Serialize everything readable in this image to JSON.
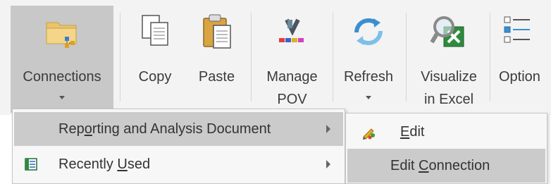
{
  "ribbon": {
    "connections": {
      "label": "Connections",
      "icon": "folder-connections-icon"
    },
    "copy": {
      "label": "Copy",
      "icon": "copy-icon"
    },
    "paste": {
      "label": "Paste",
      "icon": "paste-icon"
    },
    "manage_pov": {
      "line1": "Manage",
      "line2": "POV",
      "icon": "manage-pov-icon"
    },
    "refresh": {
      "label": "Refresh",
      "icon": "refresh-icon"
    },
    "visualize": {
      "line1": "Visualize",
      "line2": "in Excel",
      "icon": "visualize-excel-icon"
    },
    "options": {
      "label": "Option",
      "icon": "options-list-icon"
    }
  },
  "main_menu": {
    "items": [
      {
        "pre": "Rep",
        "accel": "o",
        "post": "rting and Analysis Document",
        "has_submenu": true
      },
      {
        "pre": "Recently ",
        "accel": "U",
        "post": "sed",
        "has_submenu": true,
        "icon": "document-list-icon"
      }
    ]
  },
  "sub_menu": {
    "items": [
      {
        "pre": "",
        "accel": "E",
        "post": "dit",
        "icon": "edit-icon"
      },
      {
        "pre": "Edit ",
        "accel": "C",
        "post": "onnection"
      }
    ]
  }
}
